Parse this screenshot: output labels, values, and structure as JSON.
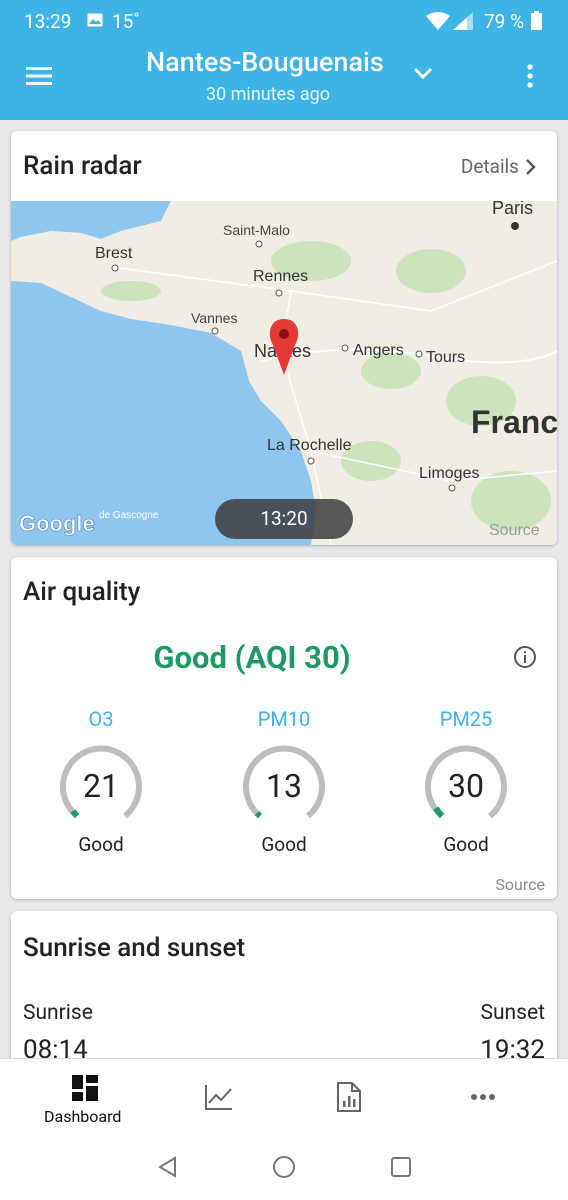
{
  "status_bar": {
    "time": "13:29",
    "temperature": "15˚",
    "battery": "79 %"
  },
  "app_bar": {
    "title": "Nantes-Bouguenais",
    "subtitle": "30 minutes ago"
  },
  "rain_radar": {
    "title": "Rain radar",
    "details_label": "Details",
    "time_label": "13:20",
    "map_source_label": "Source",
    "map_labels": {
      "paris": "Paris",
      "saint_malo": "Saint-Malo",
      "brest": "Brest",
      "rennes": "Rennes",
      "vannes": "Vannes",
      "nantes": "Nantes",
      "angers": "Angers",
      "tours": "Tours",
      "france": "France",
      "la_rochelle": "La Rochelle",
      "limoges": "Limoges",
      "gascogne": "de Gascogne",
      "google": "Google"
    }
  },
  "air_quality": {
    "title": "Air quality",
    "status": "Good (AQI 30)",
    "source_label": "Source",
    "pollutants": [
      {
        "name": "O3",
        "value": "21",
        "label": "Good"
      },
      {
        "name": "PM10",
        "value": "13",
        "label": "Good"
      },
      {
        "name": "PM25",
        "value": "30",
        "label": "Good"
      }
    ]
  },
  "sun": {
    "title": "Sunrise and sunset",
    "sunrise_label": "Sunrise",
    "sunrise_time": "08:14",
    "sunset_label": "Sunset",
    "sunset_time": "19:32"
  },
  "bottom_nav": {
    "dashboard_label": "Dashboard"
  },
  "icons": {
    "menu": "hamburger-menu-icon",
    "location_dropdown": "chevron-down-icon",
    "overflow": "more-vert-icon",
    "details": "chevron-right-icon",
    "map_pin": "map-pin-icon",
    "info": "info-icon",
    "dashboard": "dashboard-icon",
    "chart": "line-chart-icon",
    "report": "report-icon",
    "more": "more-horiz-icon"
  },
  "colors": {
    "app_bar": "#3db3e6",
    "aqi_good": "#1f9a64",
    "pollutant_name": "#3db3e6",
    "gauge_track": "#bdbdbd"
  }
}
